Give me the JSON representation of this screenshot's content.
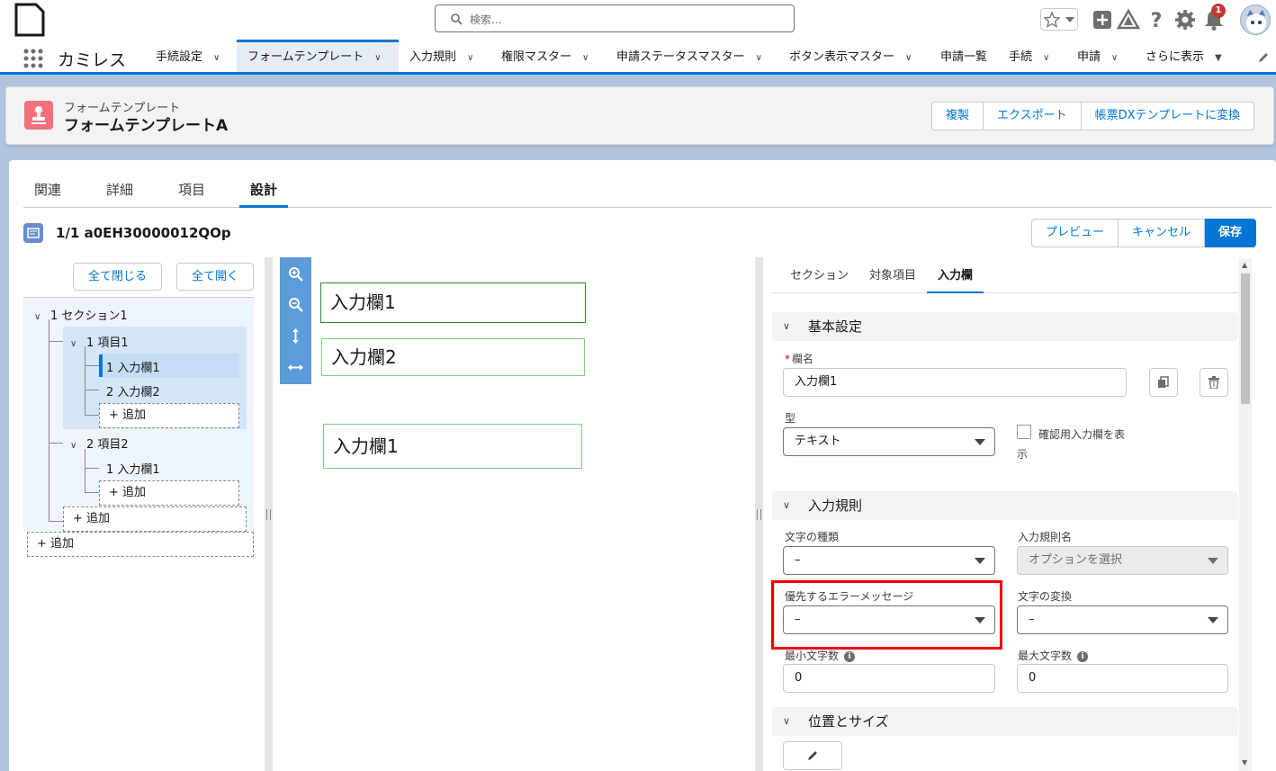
{
  "header": {
    "search_placeholder": "検索...",
    "notification_count": "1",
    "icons": [
      "document-icon",
      "search-icon",
      "star-icon",
      "add-icon",
      "trailhead-icon",
      "help-icon",
      "gear-icon",
      "bell-icon",
      "avatar-icon"
    ]
  },
  "nav": {
    "app_name": "カミレス",
    "items": [
      {
        "label": "手続設定"
      },
      {
        "label": "フォームテンプレート"
      },
      {
        "label": "入力規則"
      },
      {
        "label": "権限マスター"
      },
      {
        "label": "申請ステータスマスター"
      },
      {
        "label": "ボタン表示マスター"
      },
      {
        "label": "申請一覧"
      },
      {
        "label": "手続"
      },
      {
        "label": "申請"
      },
      {
        "label": "さらに表示"
      }
    ]
  },
  "record": {
    "type_label": "フォームテンプレート",
    "title": "フォームテンプレートA",
    "actions": [
      "複製",
      "エクスポート",
      "帳票DXテンプレートに変換"
    ]
  },
  "tabs": [
    "関連",
    "詳細",
    "項目",
    "設計"
  ],
  "design": {
    "title": "1/1 a0EH30000012QOp",
    "actions": [
      "プレビュー",
      "キャンセル",
      "保存"
    ]
  },
  "tree": {
    "collapse_all": "全て閉じる",
    "expand_all": "全て開く",
    "section": "1 セクション1",
    "item1": "1 項目1",
    "item1_field1": "1 入力欄1",
    "item1_field2": "2 入力欄2",
    "add_field1": "+ 追加",
    "item2": "2 項目2",
    "item2_field1": "1 入力欄1",
    "add_field2": "+ 追加",
    "add_item": "+ 追加",
    "add_section": "+ 追加"
  },
  "canvas": {
    "fields": [
      "入力欄1",
      "入力欄2",
      "入力欄1"
    ]
  },
  "props": {
    "tabs": [
      "セクション",
      "対象項目",
      "入力欄"
    ],
    "basic": {
      "title": "基本設定",
      "name_label": "欄名",
      "name_value": "入力欄1",
      "type_label": "型",
      "type_value": "テキスト",
      "confirm_label_line1": "確認用入力欄を表",
      "confirm_label_line2": "示"
    },
    "rules": {
      "title": "入力規則",
      "char_type_label": "文字の種類",
      "char_type_value": "–",
      "rule_name_label": "入力規則名",
      "rule_name_value": "オプションを選択",
      "error_msg_label": "優先するエラーメッセージ",
      "error_msg_value": "–",
      "char_conv_label": "文字の変換",
      "char_conv_value": "–",
      "min_len_label": "最小文字数",
      "min_len_value": "0",
      "max_len_label": "最大文字数",
      "max_len_value": "0"
    },
    "position": {
      "title": "位置とサイズ"
    }
  },
  "colors": {
    "brand": "#0176d3",
    "highlight": "#ee0000",
    "field_border": "#7ed07e"
  }
}
